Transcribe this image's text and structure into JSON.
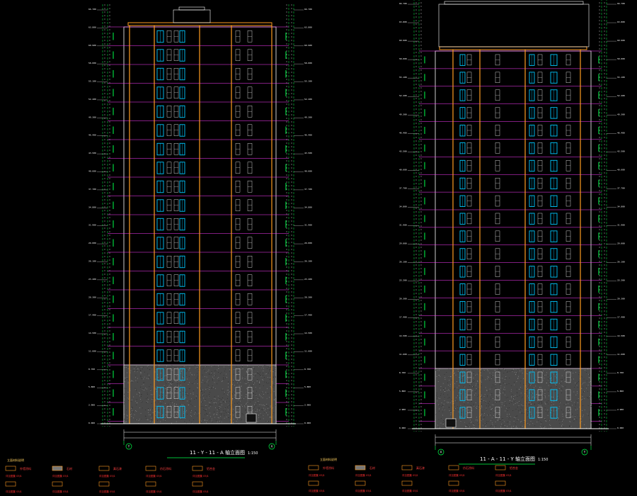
{
  "colors": {
    "background": "#000000",
    "wall": "#ffffff",
    "floor_line": "#ff3cff",
    "window": "#00c8ff",
    "pilaster": "#ff9c20",
    "green_dim": "#00ff4a",
    "red_text": "#ff3030",
    "base_fill": "#4a4a4a",
    "title_underline": "#00ff4a"
  },
  "sheets": [
    {
      "id": "left",
      "title": "11 - Y - 11 - A 轴立面图",
      "scale": "1:150",
      "axis_left": "Y",
      "axis_right": "A",
      "floors": 21,
      "base_floors": 3
    },
    {
      "id": "right",
      "title": "11 - A - 11 - Y 轴立面图",
      "scale": "1:150",
      "axis_left": "A",
      "axis_right": "Y",
      "floors": 21,
      "base_floors": 3
    }
  ],
  "legend": {
    "left": {
      "heading": "立面材料说明",
      "items": [
        "外墙涂料",
        "石材",
        "真石漆",
        "仿石涂料",
        "铝合金"
      ],
      "notes": [
        "详见图集 05J1",
        "详见图集 05J1",
        "详见图集 05J1",
        "详见图集 05J1",
        "详见图集 05J1"
      ]
    },
    "right": {
      "heading": "立面材料说明",
      "items": [
        "外墙涂料",
        "石材",
        "真石漆",
        "仿石涂料",
        "铝合金"
      ],
      "notes": [
        "详见图集 05J1",
        "详见图集 05J1",
        "详见图集 05J1",
        "详见图集 05J1",
        "详见图集 05J1"
      ]
    }
  }
}
